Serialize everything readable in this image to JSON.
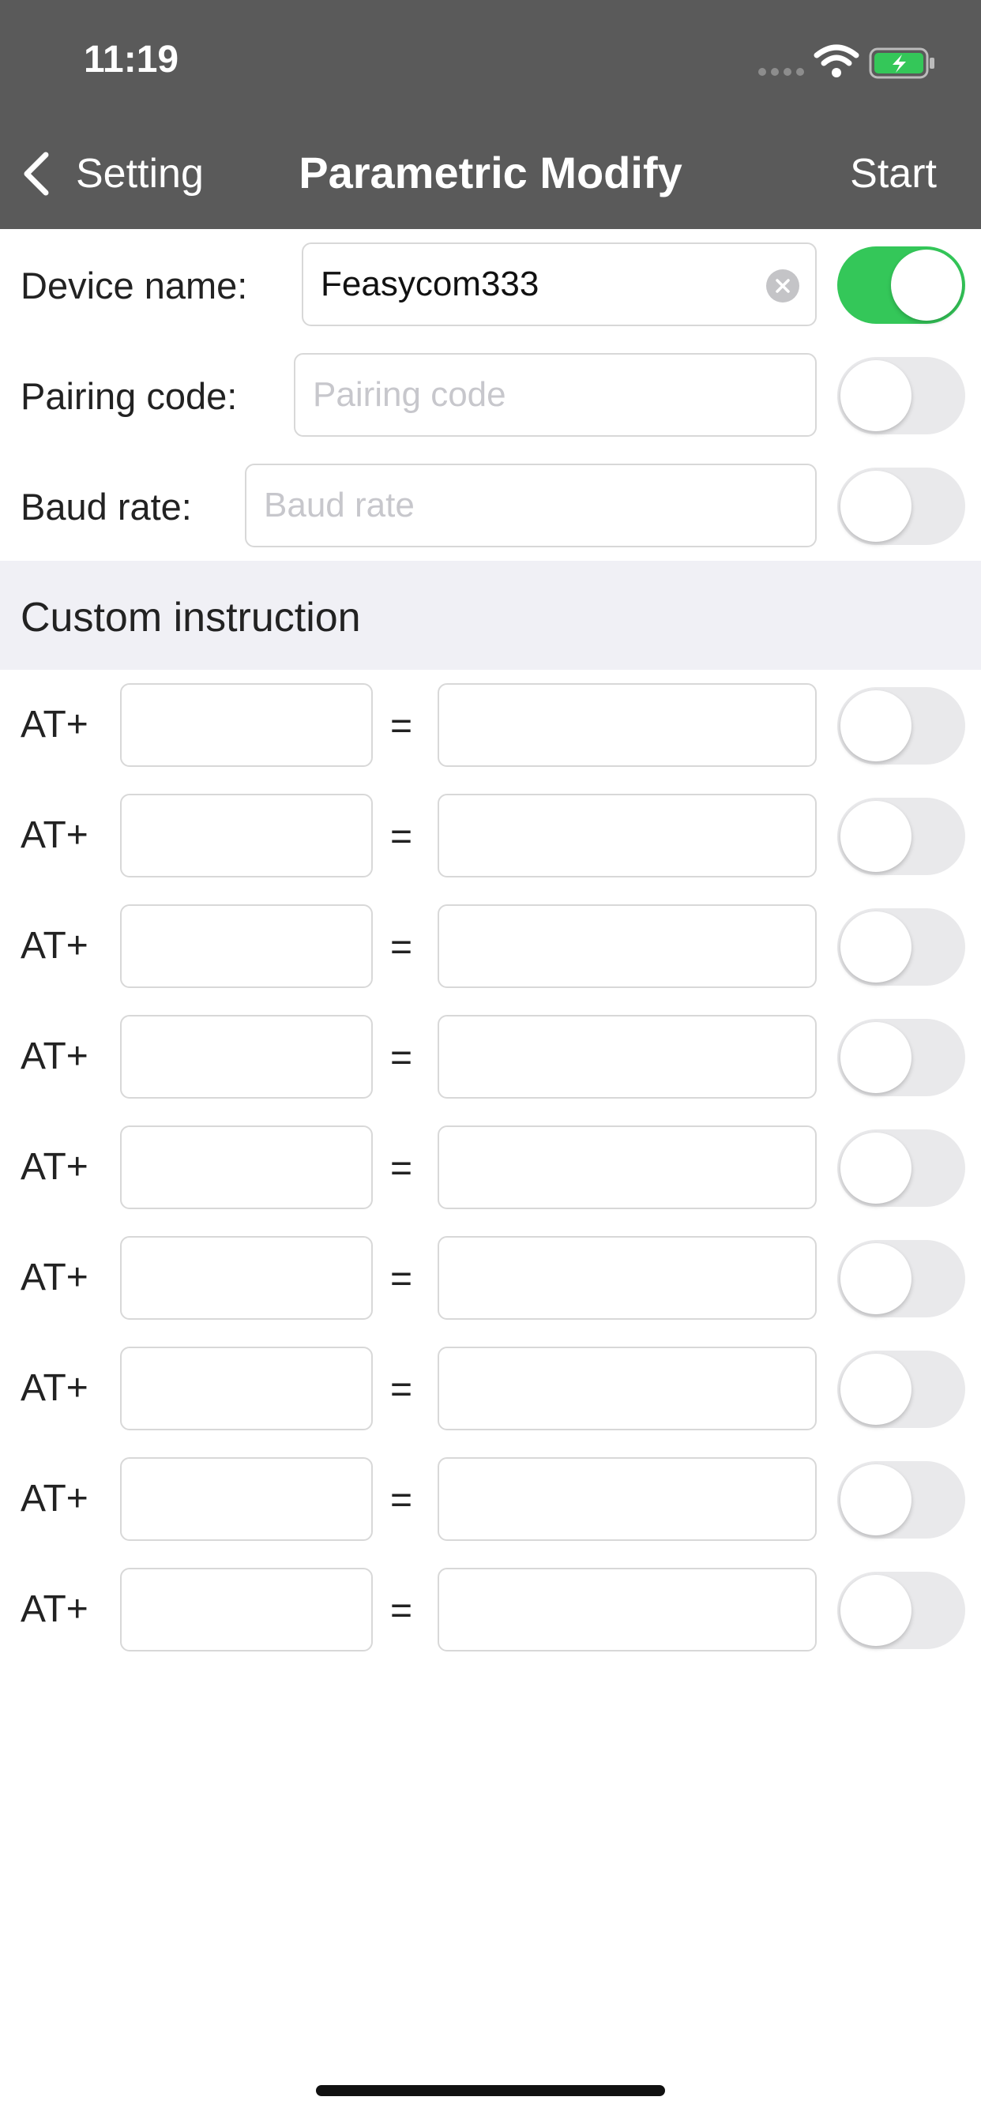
{
  "status_bar": {
    "time": "11:19"
  },
  "nav": {
    "back_label": "Setting",
    "title": "Parametric Modify",
    "start_label": "Start"
  },
  "fields": {
    "device_name": {
      "label": "Device name:",
      "value": "Feasycom333",
      "enabled": true
    },
    "pairing_code": {
      "label": "Pairing code:",
      "placeholder": "Pairing code",
      "enabled": false
    },
    "baud_rate": {
      "label": "Baud rate:",
      "placeholder": "Baud rate",
      "enabled": false
    }
  },
  "custom": {
    "title": "Custom instruction",
    "prefix": "AT+",
    "equals": "=",
    "rows": [
      {
        "cmd": "",
        "value": "",
        "enabled": false
      },
      {
        "cmd": "",
        "value": "",
        "enabled": false
      },
      {
        "cmd": "",
        "value": "",
        "enabled": false
      },
      {
        "cmd": "",
        "value": "",
        "enabled": false
      },
      {
        "cmd": "",
        "value": "",
        "enabled": false
      },
      {
        "cmd": "",
        "value": "",
        "enabled": false
      },
      {
        "cmd": "",
        "value": "",
        "enabled": false
      },
      {
        "cmd": "",
        "value": "",
        "enabled": false
      },
      {
        "cmd": "",
        "value": "",
        "enabled": false
      }
    ]
  },
  "colors": {
    "nav_bg": "#5a5a5a",
    "toggle_on": "#34c759",
    "toggle_off": "#e9e9eb",
    "section_bg": "#f0f0f5"
  }
}
